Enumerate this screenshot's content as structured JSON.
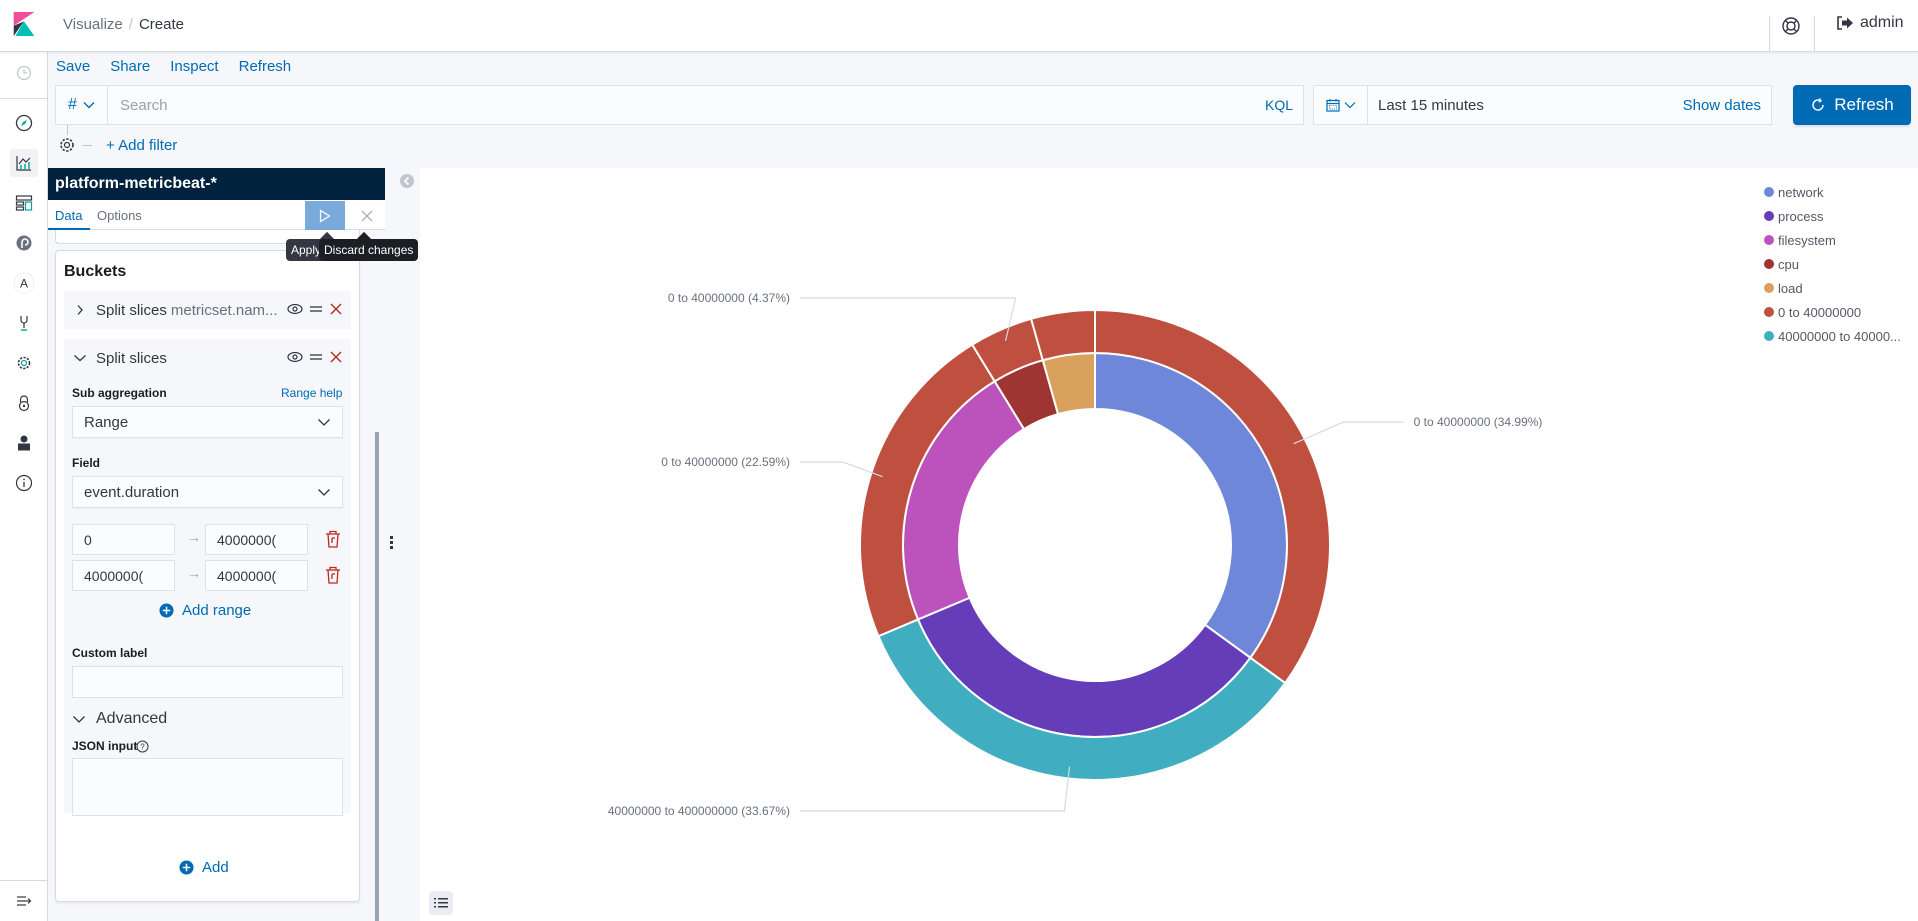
{
  "header": {
    "breadcrumbs": [
      "Visualize",
      "Create"
    ],
    "user_label": "admin",
    "help_icon": "lifebuoy-icon",
    "logout_icon": "logout-icon"
  },
  "leftnav": {
    "items": [
      {
        "name": "recently-viewed",
        "icon": "clock-icon"
      },
      {
        "name": "discover",
        "icon": "compass-icon"
      },
      {
        "name": "visualize",
        "icon": "visualize-icon",
        "active": true
      },
      {
        "name": "dashboard",
        "icon": "dashboard-icon"
      },
      {
        "name": "logs",
        "icon": "logs-icon"
      },
      {
        "name": "a-app",
        "icon": "letter-a-icon",
        "letter": "A"
      },
      {
        "name": "dev-tools",
        "icon": "wrench-icon"
      },
      {
        "name": "management",
        "icon": "gear-icon"
      },
      {
        "name": "security",
        "icon": "lock-icon"
      },
      {
        "name": "user",
        "icon": "user-icon"
      },
      {
        "name": "info",
        "icon": "info-icon"
      }
    ],
    "collapse_icon": "collapse-nav-icon"
  },
  "topnav": {
    "items": [
      "Save",
      "Share",
      "Inspect",
      "Refresh"
    ]
  },
  "query": {
    "language_symbol": "#",
    "search_placeholder": "Search",
    "search_value": "",
    "language_label": "KQL"
  },
  "time": {
    "range_label": "Last 15 minutes",
    "show_dates_label": "Show dates",
    "refresh_label": "Refresh"
  },
  "filters": {
    "add_filter_label": "+ Add filter"
  },
  "editor": {
    "index_pattern": "platform-metricbeat-*",
    "tabs": [
      {
        "label": "Data",
        "active": true
      },
      {
        "label": "Options",
        "active": false
      }
    ],
    "apply_tooltip": "Apply changes",
    "apply_tooltip_visible": "Apply",
    "discard_tooltip": "Discard changes",
    "buckets_title": "Buckets",
    "aggs": [
      {
        "title": "Split slices",
        "description": "metricset.nam...",
        "collapsed": true
      },
      {
        "title": "Split slices",
        "collapsed": false,
        "sub_aggregation_label": "Sub aggregation",
        "help_link": "Range help",
        "sub_aggregation_value": "Range",
        "field_label": "Field",
        "field_value": "event.duration",
        "ranges": [
          {
            "from": "0",
            "to": "4000000("
          },
          {
            "from": "4000000(",
            "to": "4000000("
          }
        ],
        "add_range_label": "Add range",
        "custom_label_label": "Custom label",
        "custom_label_value": "",
        "advanced_label": "Advanced",
        "json_input_label": "JSON input",
        "json_input_value": ""
      }
    ],
    "add_label": "Add"
  },
  "colors": {
    "accent": "#006bb4",
    "title_bar": "#00223e",
    "danger": "#bd271e"
  },
  "chart_data": {
    "type": "pie",
    "donut": true,
    "title": "",
    "legend_position": "top-right",
    "legend": [
      {
        "label": "network",
        "color": "#6f87d8"
      },
      {
        "label": "process",
        "color": "#663db8"
      },
      {
        "label": "filesystem",
        "color": "#bc52bc"
      },
      {
        "label": "cpu",
        "color": "#9e3533"
      },
      {
        "label": "load",
        "color": "#daa05d"
      },
      {
        "label": "0 to 40000000",
        "color": "#bf5040"
      },
      {
        "label": "40000000 to 40000...",
        "color": "#40aec0"
      }
    ],
    "inner_ring": {
      "name": "metricset.name",
      "slices": [
        {
          "label": "network",
          "percent": 34.99,
          "color": "#6f87d8"
        },
        {
          "label": "process",
          "percent": 33.67,
          "color": "#663db8"
        },
        {
          "label": "filesystem",
          "percent": 22.59,
          "color": "#bc52bc"
        },
        {
          "label": "cpu",
          "percent": 4.37,
          "color": "#9e3533"
        },
        {
          "label": "load",
          "percent": 4.38,
          "color": "#daa05d"
        }
      ]
    },
    "outer_ring": {
      "name": "event.duration ranges",
      "slices": [
        {
          "label": "0 to 40000000",
          "parent": "network",
          "percent": 34.99,
          "color": "#bf5040",
          "data_label": "0 to 40000000 (34.99%)"
        },
        {
          "label": "40000000 to 400000000",
          "parent": "process",
          "percent": 33.67,
          "color": "#40aec0",
          "data_label": "40000000 to 400000000 (33.67%)"
        },
        {
          "label": "0 to 40000000",
          "parent": "filesystem",
          "percent": 22.59,
          "color": "#bf5040",
          "data_label": "0 to 40000000 (22.59%)"
        },
        {
          "label": "0 to 40000000",
          "parent": "cpu",
          "percent": 4.37,
          "color": "#bf5040",
          "data_label": "0 to 40000000 (4.37%)"
        },
        {
          "label": "0 to 40000000",
          "parent": "load",
          "percent": 4.38,
          "color": "#bf5040",
          "data_label": ""
        }
      ]
    }
  }
}
